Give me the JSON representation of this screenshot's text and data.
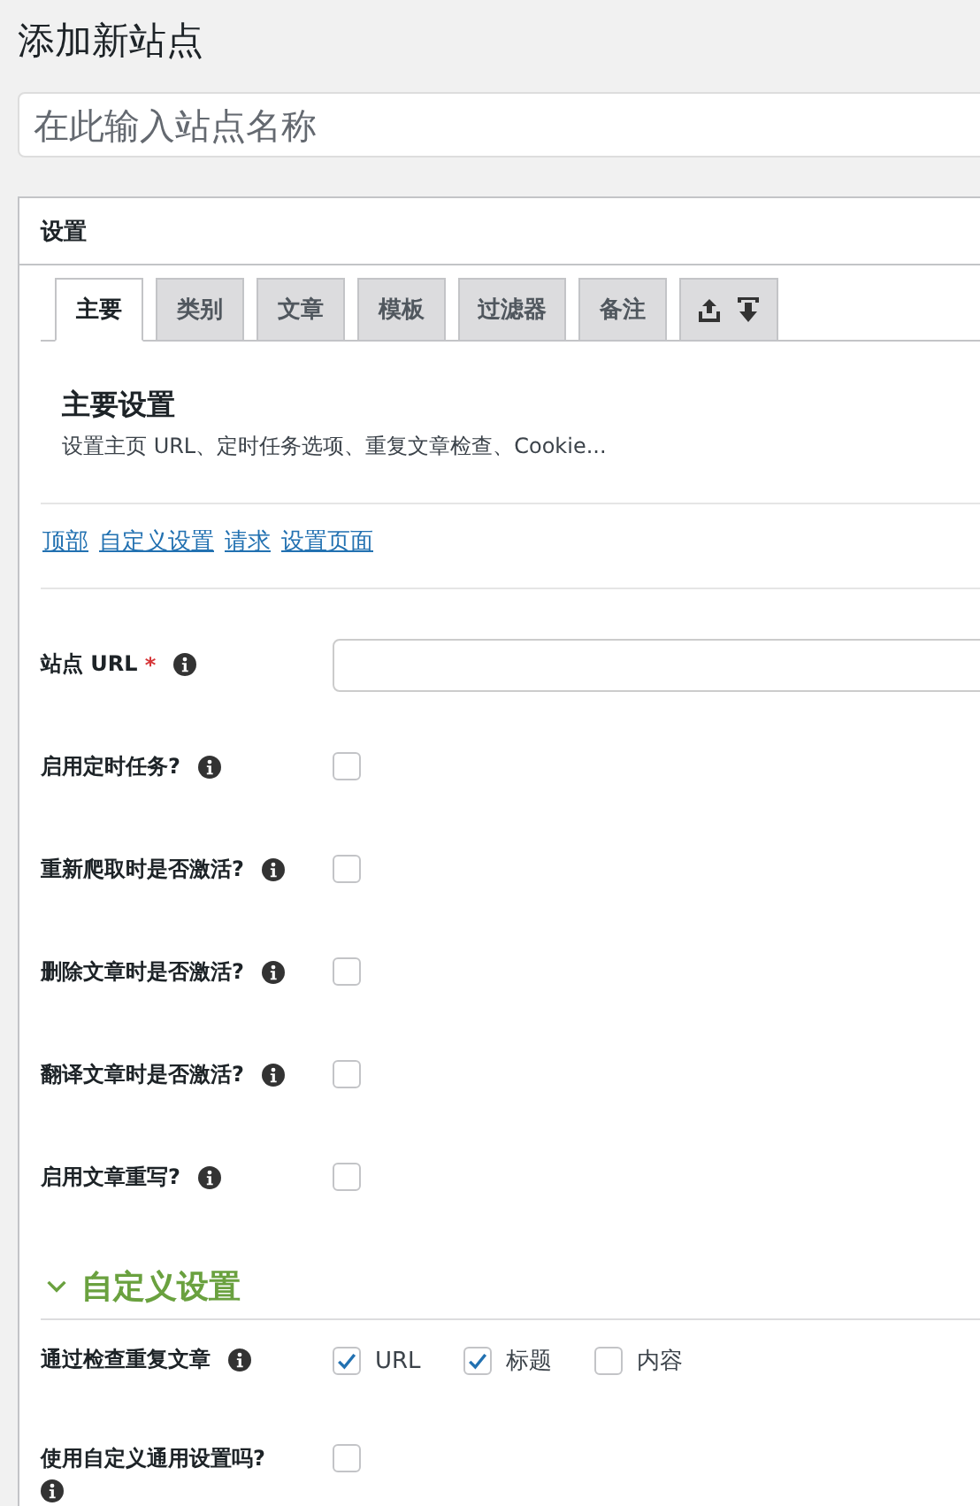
{
  "page_title": "添加新站点",
  "name_field": {
    "placeholder": "在此输入站点名称"
  },
  "panel": {
    "title": "设置",
    "tabs": [
      {
        "kind": "text",
        "label": "主要",
        "selected": true
      },
      {
        "kind": "text",
        "label": "类别",
        "selected": false
      },
      {
        "kind": "text",
        "label": "文章",
        "selected": false
      },
      {
        "kind": "text",
        "label": "模板",
        "selected": false
      },
      {
        "kind": "text",
        "label": "过滤器",
        "selected": false
      },
      {
        "kind": "text",
        "label": "备注",
        "selected": false
      },
      {
        "kind": "icons",
        "selected": false
      }
    ],
    "section_title": "主要设置",
    "section_description": "设置主页 URL、定时任务选项、重复文章检查、Cookie...",
    "quick_links": [
      "顶部",
      "自定义设置",
      "请求",
      "设置页面"
    ],
    "fields": [
      {
        "kind": "text",
        "label": "站点 URL",
        "required_mark": "*"
      },
      {
        "kind": "checkbox",
        "label": "启用定时任务?",
        "checked": false
      },
      {
        "kind": "checkbox",
        "label": "重新爬取时是否激活?",
        "checked": false
      },
      {
        "kind": "checkbox",
        "label": "删除文章时是否激活?",
        "checked": false
      },
      {
        "kind": "checkbox",
        "label": "翻译文章时是否激活?",
        "checked": false
      },
      {
        "kind": "checkbox",
        "label": "启用文章重写?",
        "checked": false
      }
    ],
    "custom_section": {
      "title": "自定义设置",
      "expanded": true,
      "fields": [
        {
          "kind": "checkgroup",
          "label": "通过检查重复文章",
          "options": [
            {
              "label": "URL",
              "checked": true
            },
            {
              "label": "标题",
              "checked": true
            },
            {
              "label": "内容",
              "checked": false
            }
          ]
        },
        {
          "kind": "checkbox",
          "label": "使用自定义通用设置吗?",
          "checked": false
        }
      ]
    }
  }
}
